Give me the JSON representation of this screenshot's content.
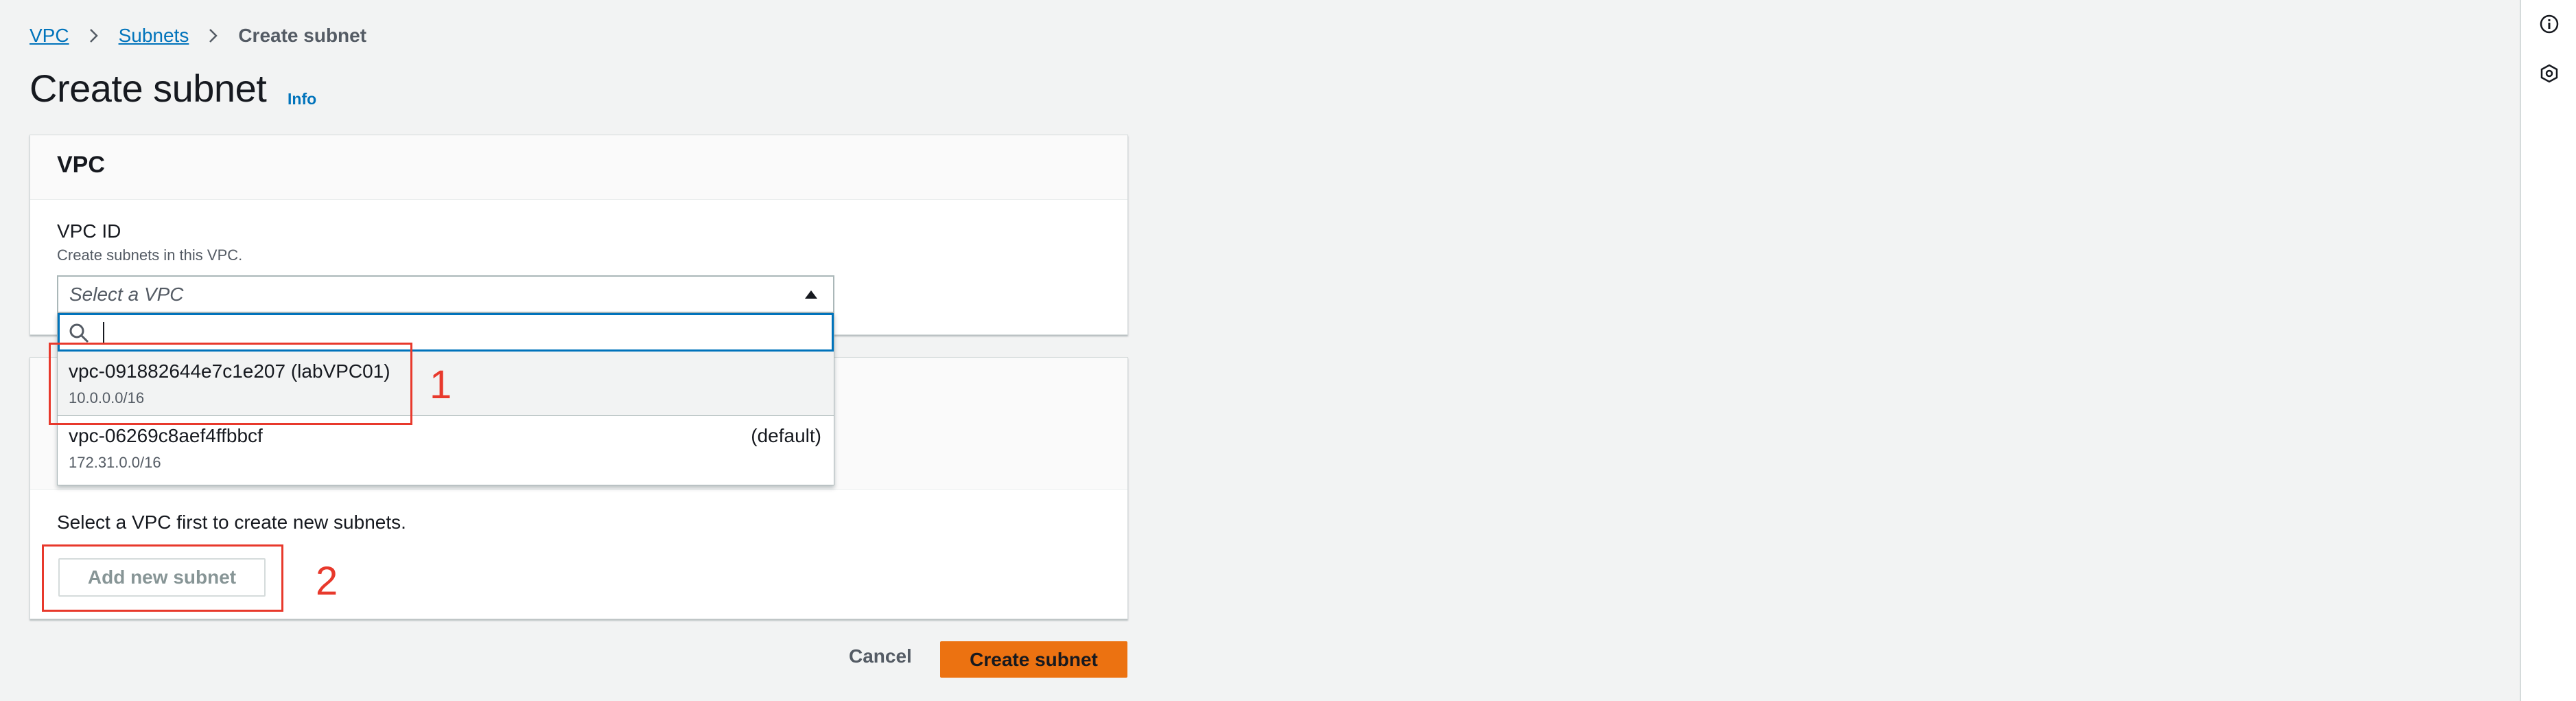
{
  "breadcrumb": {
    "items": [
      "VPC",
      "Subnets"
    ],
    "current": "Create subnet"
  },
  "page": {
    "title": "Create subnet",
    "info_label": "Info"
  },
  "vpc_panel": {
    "heading": "VPC",
    "field_label": "VPC ID",
    "field_description": "Create subnets in this VPC.",
    "select_placeholder": "Select a VPC",
    "options": [
      {
        "id": "vpc-091882644e7c1e207 (labVPC01)",
        "cidr": "10.0.0.0/16",
        "tag": ""
      },
      {
        "id": "vpc-06269c8aef4ffbbcf",
        "cidr": "172.31.0.0/16",
        "tag": "(default)"
      }
    ]
  },
  "subnet_panel": {
    "message": "Select a VPC first to create new subnets.",
    "add_button": "Add new subnet"
  },
  "footer": {
    "cancel": "Cancel",
    "create": "Create subnet"
  },
  "annotations": [
    "1",
    "2"
  ],
  "icons": [
    "chevron-right-icon",
    "caret-up-icon",
    "search-icon",
    "info-circle-icon",
    "settings-hex-icon"
  ],
  "colors": {
    "link": "#0073bb",
    "primary_button": "#ec7211",
    "annotation": "#e8392c",
    "focus": "#0073bb"
  }
}
